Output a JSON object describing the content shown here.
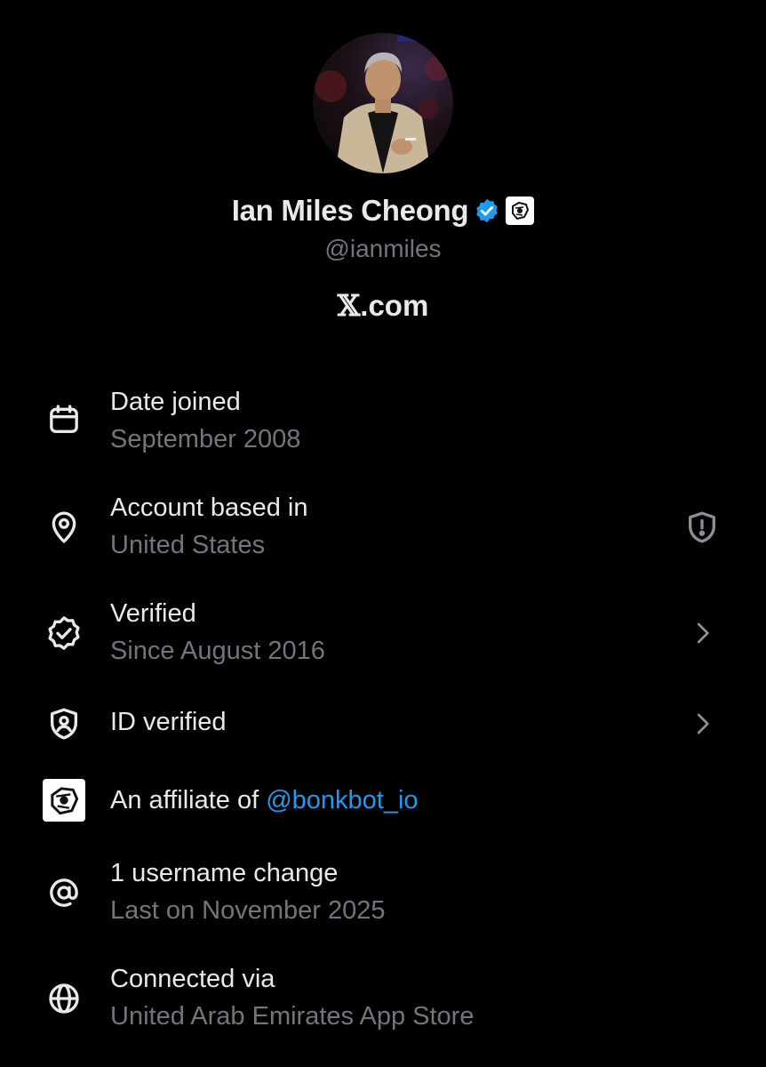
{
  "profile": {
    "display_name": "Ian Miles Cheong",
    "handle": "@ianmiles",
    "site": "X.com",
    "site_x": "𝕏",
    "site_rest": ".com",
    "verified_badge_color": "#1d9bf0"
  },
  "rows": [
    {
      "icon": "calendar-icon",
      "title": "Date joined",
      "subtitle": "September 2008"
    },
    {
      "icon": "location-pin-icon",
      "title": "Account based in",
      "subtitle": "United States",
      "trailing_icon": "shield-alert-icon"
    },
    {
      "icon": "verified-badge-icon",
      "title": "Verified",
      "subtitle": "Since August 2016",
      "trailing_icon": "chevron-right-icon"
    },
    {
      "icon": "id-shield-icon",
      "title": "ID verified",
      "trailing_icon": "chevron-right-icon"
    },
    {
      "icon": "affiliate-logo-icon",
      "title_prefix": "An affiliate of ",
      "title_link": "@bonkbot_io"
    },
    {
      "icon": "at-sign-icon",
      "title": "1 username change",
      "subtitle": "Last on November 2025"
    },
    {
      "icon": "globe-icon",
      "title": "Connected via",
      "subtitle": "United Arab Emirates App Store"
    }
  ],
  "colors": {
    "background": "#000000",
    "primary_text": "#e7e9ea",
    "secondary_text": "#71767b",
    "link": "#1d9bf0"
  }
}
